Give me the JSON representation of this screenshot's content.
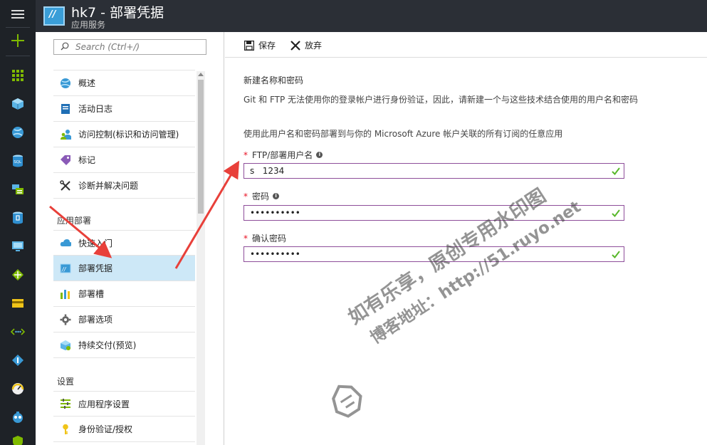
{
  "header": {
    "title": "hk7 - 部署凭据",
    "subtitle": "应用服务"
  },
  "leftbar": {
    "items": [
      "hamburger-icon",
      "plus-icon",
      "dashboard-icon",
      "cube-icon",
      "globe-icon",
      "sql-icon",
      "storage-icon",
      "cosmos-icon",
      "monitor-icon",
      "network-icon",
      "card-icon",
      "connection-icon",
      "diamond-icon",
      "gauge-icon",
      "bot-icon",
      "shield-icon"
    ]
  },
  "menu": {
    "search_placeholder": "Search (Ctrl+/)",
    "items_top": [
      {
        "label": "概述",
        "icon": "globe-icon"
      },
      {
        "label": "活动日志",
        "icon": "log-icon"
      },
      {
        "label": "访问控制(标识和访问管理)",
        "icon": "users-icon"
      },
      {
        "label": "标记",
        "icon": "tag-icon"
      },
      {
        "label": "诊断并解决问题",
        "icon": "wrench-icon"
      }
    ],
    "section_deploy": "应用部署",
    "items_deploy": [
      {
        "label": "快速入门",
        "icon": "cloud-icon"
      },
      {
        "label": "部署凭据",
        "icon": "credentials-icon"
      },
      {
        "label": "部署槽",
        "icon": "slots-icon"
      },
      {
        "label": "部署选项",
        "icon": "gear-icon"
      },
      {
        "label": "持续交付(预览)",
        "icon": "delivery-icon"
      }
    ],
    "section_settings": "设置",
    "items_settings": [
      {
        "label": "应用程序设置",
        "icon": "settings-list-icon"
      },
      {
        "label": "身份验证/授权",
        "icon": "key-icon"
      }
    ]
  },
  "toolbar": {
    "save_label": "保存",
    "discard_label": "放弃"
  },
  "form": {
    "section_title": "新建名称和密码",
    "desc1": "Git 和 FTP 无法使用你的登录帐户进行身份验证，因此，请新建一个与这些技术结合使用的用户名和密码",
    "desc2": "使用此用户名和密码部署到与你的 Microsoft Azure 帐户关联的所有订阅的任意应用",
    "username_label": "FTP/部署用户名",
    "username_value": "s   1234",
    "password_label": "密码",
    "password_value": "••••••••••",
    "confirm_label": "确认密码",
    "confirm_value": "••••••••••"
  },
  "watermark": {
    "line1": "如有乐享，原创专用水印图",
    "line2": "博客地址：http://51.ruyo.net"
  },
  "colors": {
    "header_bg": "#2b2f36",
    "leftbar_bg": "#1e2227",
    "selected_bg": "#cde8f7",
    "field_border": "#8e4e9a",
    "check_green": "#58b72a",
    "required_red": "#e81123",
    "arrow_red": "#e8403a"
  }
}
